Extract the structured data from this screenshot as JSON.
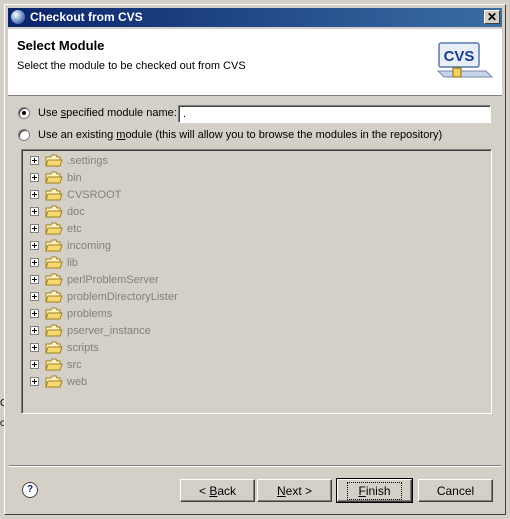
{
  "window": {
    "title": "Checkout from CVS",
    "close_glyph": "✕"
  },
  "banner": {
    "title": "Select Module",
    "subtitle": "Select the module to be checked out from CVS",
    "logo_text": "CVS"
  },
  "options": {
    "specified": {
      "label_before": "Use ",
      "label_mnemonic": "s",
      "label_after": "pecified module name:",
      "checked": true
    },
    "existing": {
      "label_before": "Use an existing ",
      "label_mnemonic": "m",
      "label_after": "odule (this will allow you to browse the modules in the repository)",
      "checked": false
    },
    "module_input_value": "."
  },
  "tree": {
    "items": [
      {
        "label": ".settings"
      },
      {
        "label": "bin"
      },
      {
        "label": "CVSROOT"
      },
      {
        "label": "doc"
      },
      {
        "label": "etc"
      },
      {
        "label": "incoming"
      },
      {
        "label": "lib"
      },
      {
        "label": "perlProblemServer"
      },
      {
        "label": "problemDirectoryLister"
      },
      {
        "label": "problems"
      },
      {
        "label": "pserver_instance"
      },
      {
        "label": "scripts"
      },
      {
        "label": "src"
      },
      {
        "label": "web"
      }
    ]
  },
  "background": {
    "fragment_1": "Co",
    "fragment_2": "or"
  },
  "buttons": {
    "help": "?",
    "back": {
      "before": "< ",
      "mnemonic": "B",
      "after": "ack"
    },
    "next": {
      "before": "",
      "mnemonic": "N",
      "after": "ext >"
    },
    "finish": {
      "before": "",
      "mnemonic": "F",
      "after": "inish"
    },
    "cancel": "Cancel"
  }
}
